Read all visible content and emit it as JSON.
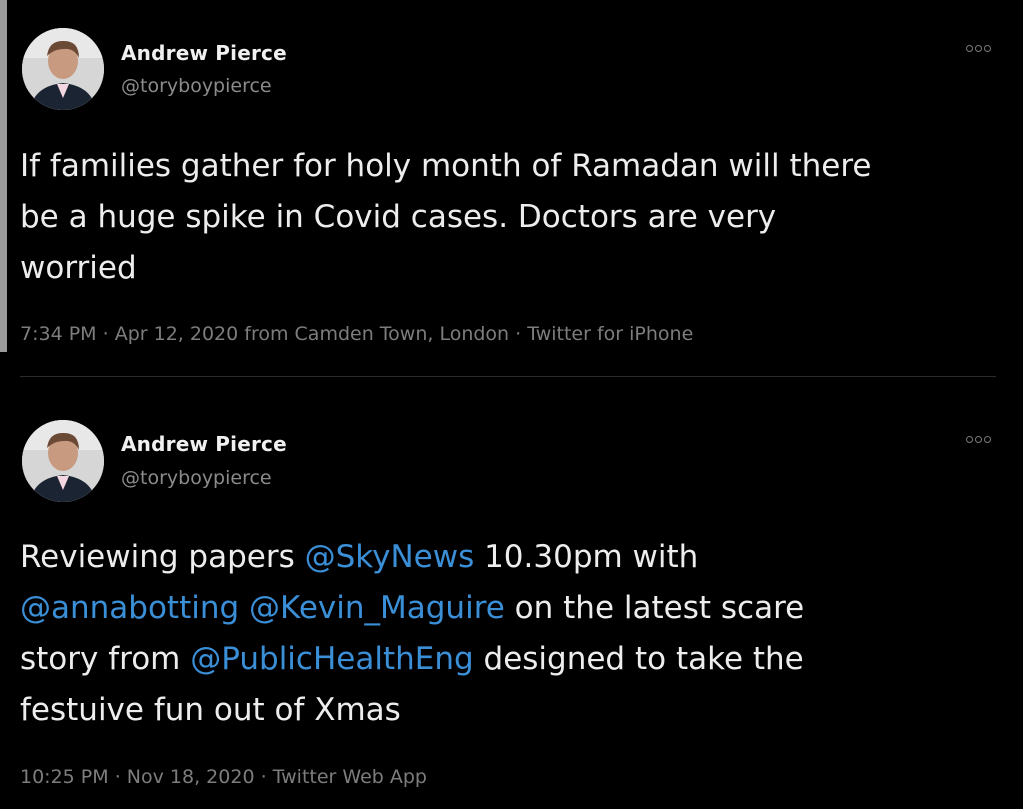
{
  "tweets": [
    {
      "author": {
        "name": "Andrew Pierce",
        "handle": "@toryboypierce"
      },
      "text_lines": [
        "If families gather for holy month of Ramadan will there",
        "be a huge spike in Covid cases. Doctors are very",
        "worried"
      ],
      "meta": {
        "time": "7:34 PM",
        "date": "Apr 12, 2020",
        "location": "from Camden Town, London",
        "client": "Twitter for iPhone"
      }
    },
    {
      "author": {
        "name": "Andrew Pierce",
        "handle": "@toryboypierce"
      },
      "text": {
        "line1_pre": "Reviewing papers ",
        "mention1": "@SkyNews",
        "line1_post": " 10.30pm with",
        "mention2": "@annabotting",
        "mention3": "@Kevin_Maguire",
        "line2_post": " on the latest scare",
        "line3_pre": "story from ",
        "mention4": "@PublicHealthEng",
        "line3_post": "  designed to take the",
        "line4": "festuive fun out of Xmas"
      },
      "meta": {
        "time": "10:25 PM",
        "date": "Nov 18, 2020",
        "client": "Twitter Web App"
      }
    }
  ],
  "icons": {
    "avatar": "avatar-photo",
    "more": "more-options-icon"
  },
  "colors": {
    "background": "#000000",
    "text": "#ededed",
    "muted": "#7d7d7d",
    "mention": "#3a8fd7"
  }
}
